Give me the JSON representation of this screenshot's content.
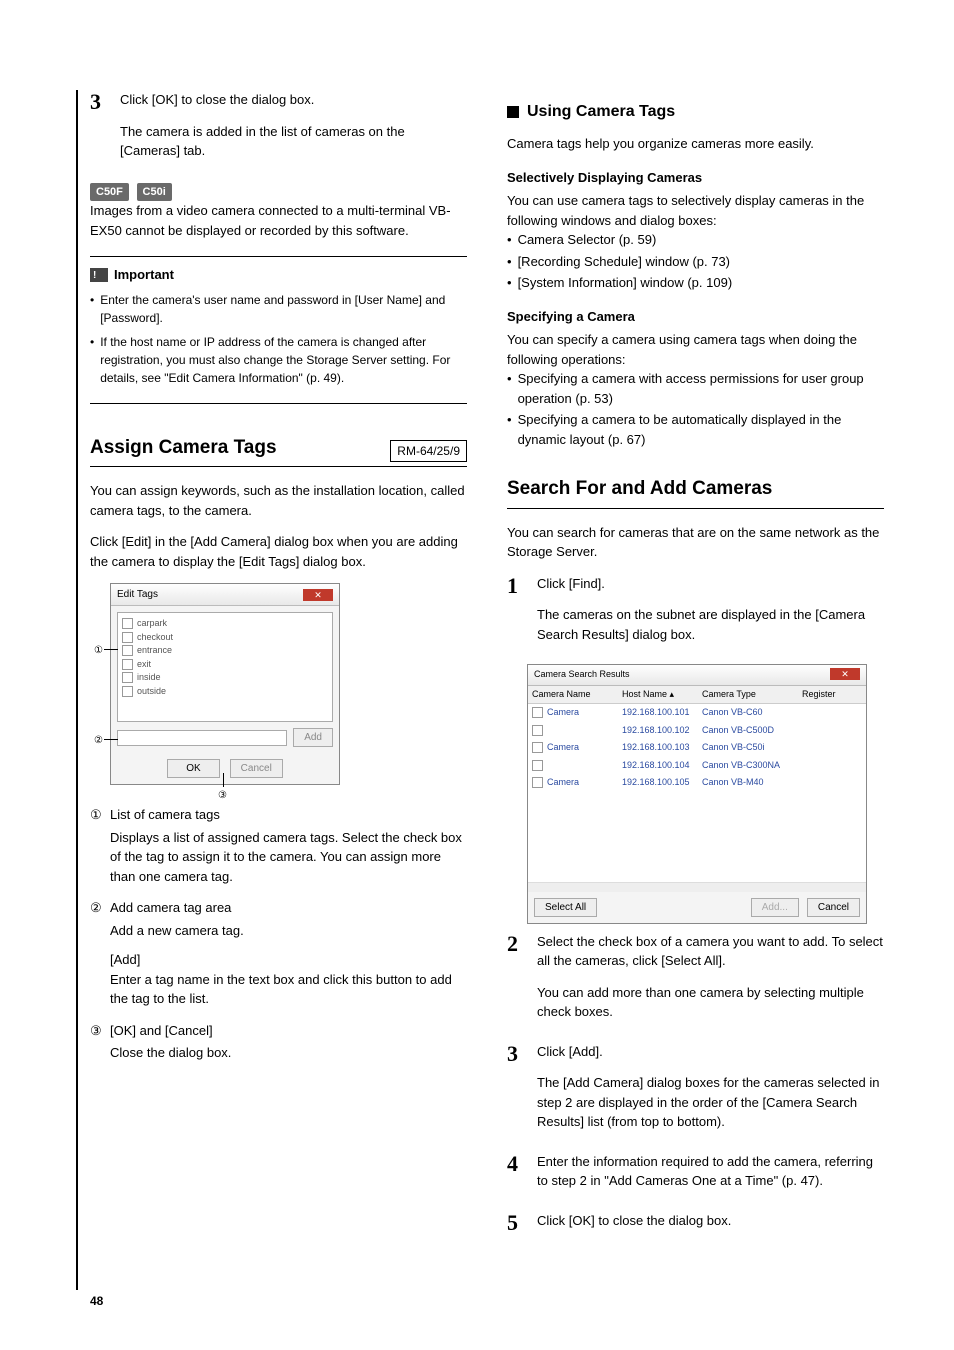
{
  "pageNumber": "48",
  "left": {
    "steps": {
      "three": {
        "num": "3",
        "main": "Click [OK] to close the dialog box.",
        "sub": "The camera is added in the list of cameras on the [Cameras] tab."
      }
    },
    "badges": {
      "c50f": "C50F",
      "c50i": "C50i"
    },
    "multiTerminal": "Images from a video camera connected to a multi-terminal VB-EX50 cannot be displayed or recorded by this software.",
    "important": {
      "label": "Important",
      "items": [
        "Enter the camera's user name and password in [User Name] and [Password].",
        "If the host name or IP address of the camera is changed after registration, you must also change the Storage Server setting. For details, see \"Edit Camera Information\" (p. 49)."
      ]
    },
    "assign": {
      "title": "Assign Camera Tags",
      "badge": "RM-64/25/9",
      "p1": "You can assign keywords, such as the installation location, called camera tags, to the camera.",
      "p2": "Click [Edit] in the [Add Camera] dialog box when you are adding the camera to display the [Edit Tags] dialog box."
    },
    "editTags": {
      "title": "Edit Tags",
      "items": [
        "carpark",
        "checkout",
        "entrance",
        "exit",
        "inside",
        "outside"
      ],
      "addBtn": "Add",
      "ok": "OK",
      "cancel": "Cancel"
    },
    "definitions": {
      "d1": {
        "num": "①",
        "term": "List of camera tags",
        "desc": "Displays a list of assigned camera tags. Select the check box of the tag to assign it to the camera. You can assign more than one camera tag."
      },
      "d2": {
        "num": "②",
        "term": "Add camera tag area",
        "desc": "Add a new camera tag.",
        "subTerm": "[Add]",
        "subDesc": "Enter a tag name in the text box and click this button to add the tag to the list."
      },
      "d3": {
        "num": "③",
        "term": "[OK] and [Cancel]",
        "desc": "Close the dialog box."
      }
    }
  },
  "right": {
    "usingTags": {
      "title": "Using Camera Tags",
      "intro": "Camera tags help you organize cameras more easily.",
      "sel": {
        "hdr": "Selectively Displaying Cameras",
        "lead": "You can use camera tags to selectively display cameras in the following windows and dialog boxes:",
        "items": [
          "Camera Selector (p. 59)",
          "[Recording Schedule] window (p. 73)",
          "[System Information] window (p. 109)"
        ]
      },
      "spec": {
        "hdr": "Specifying a Camera",
        "lead": "You can specify a camera using camera tags when doing the following operations:",
        "items": [
          "Specifying a camera with access permissions for user group operation (p. 53)",
          "Specifying a camera to be automatically displayed in the dynamic layout (p. 67)"
        ]
      }
    },
    "search": {
      "title": "Search For and Add Cameras",
      "intro": "You can search for cameras that are on the same network as the Storage Server.",
      "s1": {
        "num": "1",
        "main": "Click [Find].",
        "sub": "The cameras on the subnet are displayed in the [Camera Search Results] dialog box."
      },
      "csr": {
        "title": "Camera Search Results",
        "headers": {
          "c1": "Camera Name",
          "c2": "Host Name ▴",
          "c3": "Camera Type",
          "c4": "Register"
        },
        "rows": [
          {
            "name": "Camera",
            "host": "192.168.100.101",
            "type": "Canon VB-C60"
          },
          {
            "name": "",
            "host": "192.168.100.102",
            "type": "Canon VB-C500D"
          },
          {
            "name": "Camera",
            "host": "192.168.100.103",
            "type": "Canon VB-C50i"
          },
          {
            "name": "",
            "host": "192.168.100.104",
            "type": "Canon VB-C300NA"
          },
          {
            "name": "Camera",
            "host": "192.168.100.105",
            "type": "Canon VB-M40"
          }
        ],
        "selectAll": "Select All",
        "add": "Add...",
        "cancel": "Cancel"
      },
      "s2": {
        "num": "2",
        "main": "Select the check box of a camera you want to add. To select all the cameras, click [Select All].",
        "sub": "You can add more than one camera by selecting multiple check boxes."
      },
      "s3": {
        "num": "3",
        "main": "Click [Add].",
        "sub": "The [Add Camera] dialog boxes for the cameras selected in step 2 are displayed in the order of the [Camera Search Results] list (from top to bottom)."
      },
      "s4": {
        "num": "4",
        "main": "Enter the information required to add the camera, referring to step 2 in \"Add Cameras One at a Time\" (p. 47)."
      },
      "s5": {
        "num": "5",
        "main": "Click [OK] to close the dialog box."
      }
    }
  },
  "callouts": {
    "one": "①",
    "two": "②",
    "three": "③"
  }
}
